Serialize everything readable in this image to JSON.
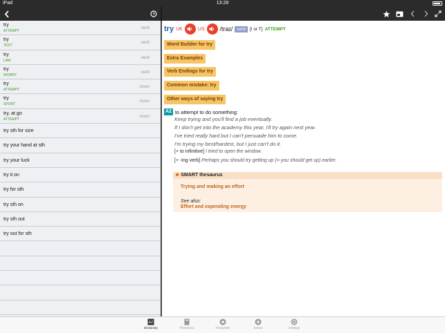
{
  "status": {
    "carrier": "iPad",
    "time": "13:28"
  },
  "nav": {
    "back_icon": "chevron-left-icon",
    "history_icon": "clock-icon",
    "favourite_icon": "star-icon",
    "card_icon": "card-icon",
    "prev_icon": "chevron-left-icon",
    "next_icon": "chevron-right-icon",
    "expand_icon": "expand-icon"
  },
  "results": [
    {
      "word": "try",
      "sub": "ATTEMPT",
      "pos": "verb"
    },
    {
      "word": "try",
      "sub": "TEST",
      "pos": "verb"
    },
    {
      "word": "try",
      "sub": "LAW",
      "pos": "verb"
    },
    {
      "word": "try",
      "sub": "WORRY",
      "pos": "verb"
    },
    {
      "word": "try",
      "sub": "ATTEMPT",
      "pos": "noun"
    },
    {
      "word": "try",
      "sub": "SPORT",
      "pos": "noun"
    },
    {
      "word": "try, at go",
      "sub": "ATTEMPT",
      "pos": "noun"
    },
    {
      "word": "try sth for size",
      "sub": "",
      "pos": ""
    },
    {
      "word": "try your hand at sth",
      "sub": "",
      "pos": ""
    },
    {
      "word": "try your luck",
      "sub": "",
      "pos": ""
    },
    {
      "word": "try it on",
      "sub": "",
      "pos": ""
    },
    {
      "word": "try for sth",
      "sub": "",
      "pos": ""
    },
    {
      "word": "try sth on",
      "sub": "",
      "pos": ""
    },
    {
      "word": "try sth out",
      "sub": "",
      "pos": ""
    },
    {
      "word": "try out for sth",
      "sub": "",
      "pos": ""
    },
    {
      "word": "",
      "sub": "",
      "pos": ""
    },
    {
      "word": "",
      "sub": "",
      "pos": ""
    },
    {
      "word": "",
      "sub": "",
      "pos": ""
    },
    {
      "word": "",
      "sub": "",
      "pos": ""
    },
    {
      "word": "",
      "sub": "",
      "pos": ""
    }
  ],
  "entry": {
    "headword": "try",
    "uk": "UK",
    "us": "US",
    "ipa": "/traɪ/",
    "pos": "verb",
    "grammar": "[I or T]",
    "guideword": "ATTEMPT",
    "buttons": [
      "Word Builder for try",
      "Extra Examples",
      "Verb Endings for try",
      "Common mistake: try",
      "Other ways of saying try"
    ],
    "level": "A2",
    "definition": "to attempt to do something:",
    "examples": [
      "Keep trying and you'll find a job eventually.",
      "If I don't get into the academy this year, I'll try again next year.",
      "I've tried really hard but I can't persuade him to come.",
      "I'm trying my best/hardest, but I just can't do it."
    ],
    "gram1_label": "[+ to infinitive]",
    "gram1_example": "I tried to open the window.",
    "gram2_label": "[+ -ing verb]",
    "gram2_example": "Perhaps you should try getting up (= you should get up) earlier.",
    "thesaurus": {
      "title": "SMART thesaurus",
      "link1": "Trying and making an effort",
      "see_also": "See also:",
      "link2": "Effort and expending energy"
    }
  },
  "tabs": [
    {
      "label": "Dictionary",
      "icon": "dictionary-icon"
    },
    {
      "label": "Thesaurus",
      "icon": "thesaurus-icon"
    },
    {
      "label": "Favourites",
      "icon": "star-icon"
    },
    {
      "label": "Extras",
      "icon": "plus-icon"
    },
    {
      "label": "Settings",
      "icon": "gear-icon"
    }
  ]
}
